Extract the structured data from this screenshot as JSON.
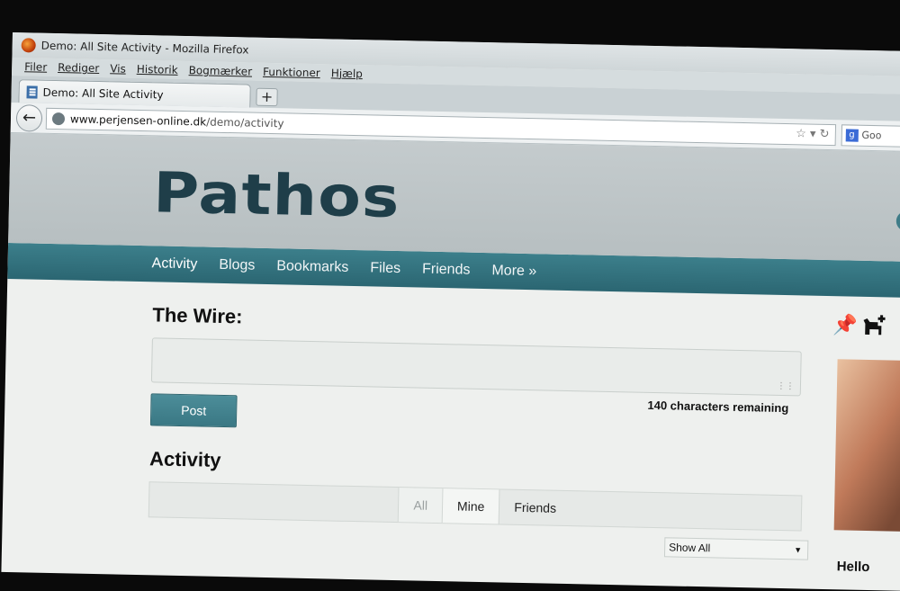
{
  "browser": {
    "window_title": "Demo: All Site Activity - Mozilla Firefox",
    "menu": [
      "Filer",
      "Rediger",
      "Vis",
      "Historik",
      "Bogmærker",
      "Funktioner",
      "Hjælp"
    ],
    "tab_title": "Demo: All Site Activity",
    "new_tab": "+",
    "url_host": "www.perjensen-online.dk",
    "url_path": "/demo/activity",
    "search_text": "Goo"
  },
  "site": {
    "logo": "Pathos",
    "nav": [
      "Activity",
      "Blogs",
      "Bookmarks",
      "Files",
      "Friends",
      "More »"
    ]
  },
  "wire": {
    "heading": "The Wire:",
    "chars_remaining": "140 characters remaining",
    "post_label": "Post"
  },
  "activity": {
    "heading": "Activity",
    "tabs": [
      "All",
      "Mine",
      "Friends"
    ],
    "filter": "Show All"
  },
  "sidebar": {
    "greeting": "Hello"
  }
}
